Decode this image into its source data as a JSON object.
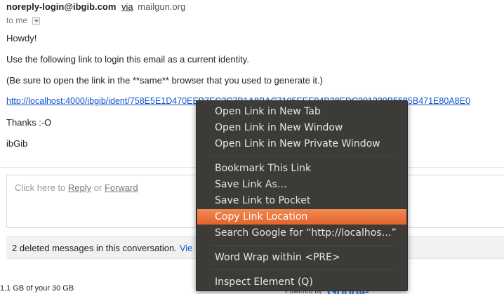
{
  "email": {
    "sender_email": "noreply-login@ibgib.com",
    "via_label": "via",
    "via_domain": "mailgun.org",
    "to_label": "to me",
    "greeting": "Howdy!",
    "instruction": "Use the following link to login this email as a current identity.",
    "note": "(Be sure to open the link in the **same** browser that you used to generate it.)",
    "login_link": "http://localhost:4000/ibgib/ident/758E5E1D470EEB7EC3C7B1A8BAC7105EEE94B28EDC201230B5585B471E80A8E0",
    "thanks": "Thanks :-O",
    "signature": "ibGib"
  },
  "reply": {
    "prefix": "Click here to",
    "reply_label": "Reply",
    "or_label": "or",
    "forward_label": "Forward"
  },
  "deleted_bar": {
    "text": "2 deleted messages in this conversation.",
    "view_label": "Vie"
  },
  "footer": {
    "storage": "1.1 GB of your 30 GB",
    "powered_by": "Powered by",
    "google": "Google"
  },
  "context_menu": {
    "items": [
      {
        "label": "Open Link in New Tab"
      },
      {
        "label": "Open Link in New Window"
      },
      {
        "label": "Open Link in New Private Window"
      },
      {
        "label": "Bookmark This Link"
      },
      {
        "label": "Save Link As…"
      },
      {
        "label": "Save Link to Pocket"
      },
      {
        "label": "Copy Link Location",
        "highlighted": true
      },
      {
        "label": "Search Google for “http://localhos…”"
      },
      {
        "label": "Word Wrap within <PRE>"
      },
      {
        "label": "Inspect Element (Q)"
      }
    ]
  },
  "colors": {
    "link": "#1155cc",
    "menu_background": "#3c3b37",
    "menu_highlight": "#e9703a"
  }
}
